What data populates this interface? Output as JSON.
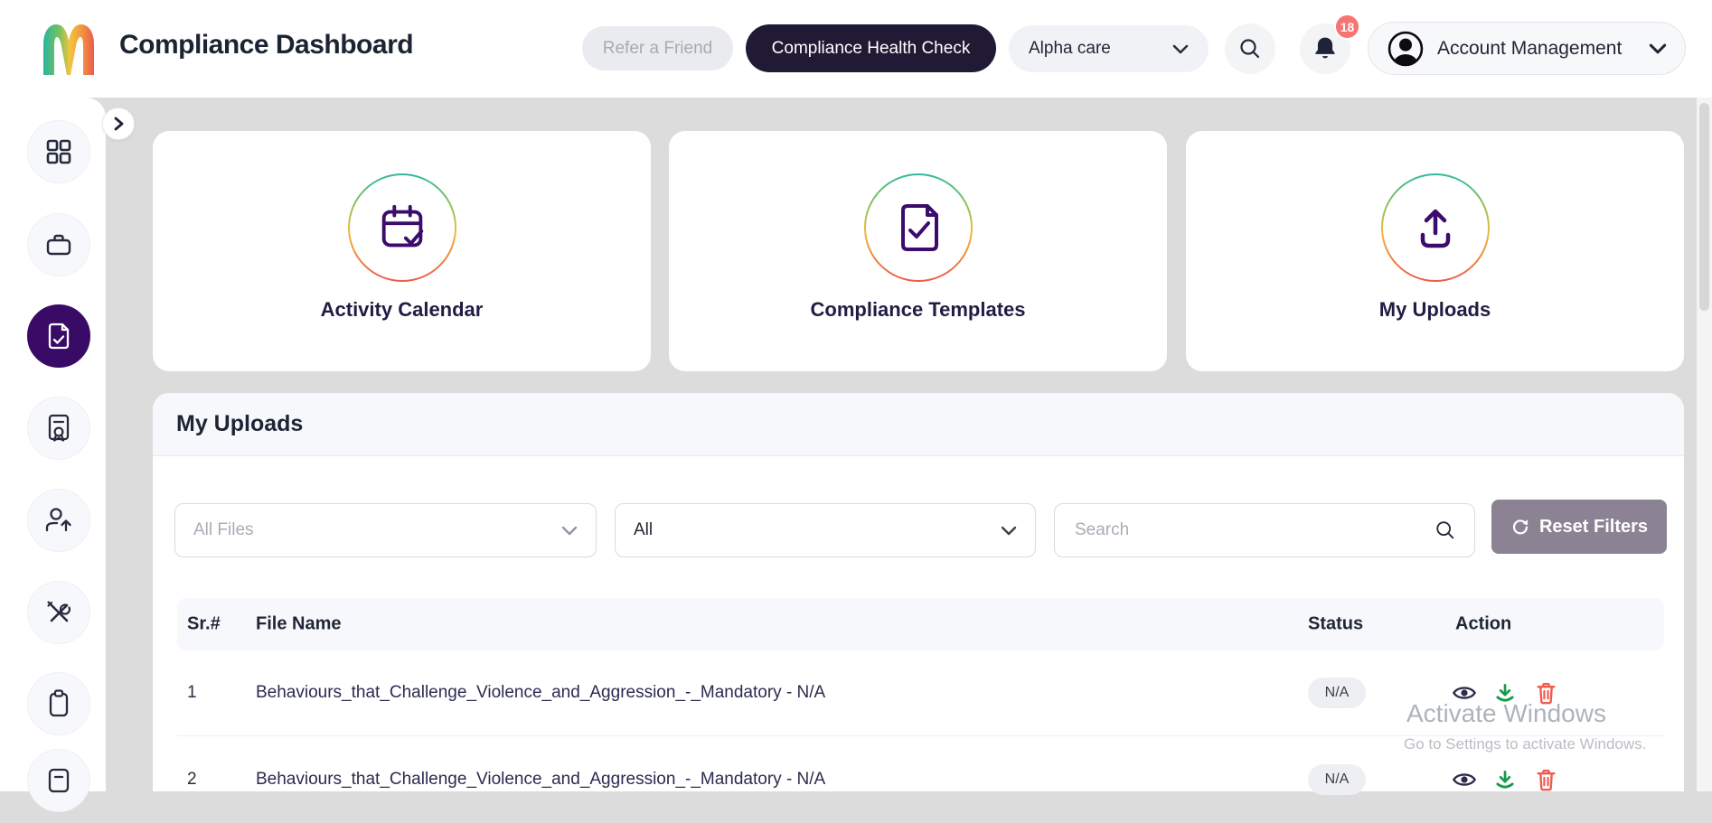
{
  "header": {
    "app_title": "Compliance Dashboard",
    "refer_button": "Refer a Friend",
    "health_check_button": "Compliance Health Check",
    "org_select_value": "Alpha care",
    "notification_badge": "18",
    "account_button": "Account Management"
  },
  "sidebar": {
    "items": [
      {
        "icon": "dashboard-grid-icon",
        "active": false
      },
      {
        "icon": "briefcase-icon",
        "active": false
      },
      {
        "icon": "document-check-icon",
        "active": true
      },
      {
        "icon": "certificate-icon",
        "active": false
      },
      {
        "icon": "user-upload-icon",
        "active": false
      },
      {
        "icon": "tools-icon",
        "active": false
      },
      {
        "icon": "clipboard-icon",
        "active": false
      },
      {
        "icon": "report-icon",
        "active": false
      }
    ]
  },
  "cards": [
    {
      "label": "Activity Calendar",
      "icon": "calendar-check-icon"
    },
    {
      "label": "Compliance Templates",
      "icon": "file-check-icon"
    },
    {
      "label": "My Uploads",
      "icon": "upload-icon"
    }
  ],
  "uploads_section": {
    "title": "My Uploads",
    "filters": {
      "file_filter_placeholder": "All Files",
      "status_filter_value": "All",
      "search_placeholder": "Search",
      "reset_button": "Reset Filters"
    },
    "table": {
      "headers": [
        "Sr.#",
        "File Name",
        "Status",
        "Action"
      ],
      "rows": [
        {
          "sr": "1",
          "file_name": "Behaviours_that_Challenge_Violence_and_Aggression_-_Mandatory - N/A",
          "status": "N/A"
        },
        {
          "sr": "2",
          "file_name": "Behaviours_that_Challenge_Violence_and_Aggression_-_Mandatory - N/A",
          "status": "N/A"
        }
      ]
    }
  },
  "watermark": {
    "line1": "Activate Windows",
    "line2": "Go to Settings to activate Windows."
  },
  "colors": {
    "accent_purple": "#3c0c6d",
    "active_nav": "#3a0b66",
    "dark_navy": "#1e2435",
    "health_pill": "#211a34",
    "badge_red": "#f97373",
    "download_green": "#169a4c",
    "delete_red": "#f15b4e",
    "reset_gray": "#8b8393",
    "gradient_top": "#2eb8a2",
    "gradient_mid": "#f2b93e",
    "gradient_bottom": "#ee5a50"
  }
}
